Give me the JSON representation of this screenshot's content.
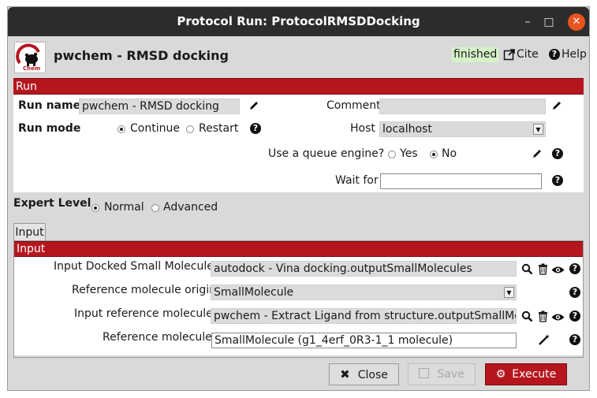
{
  "window": {
    "title": "Protocol Run: ProtocolRMSDDocking"
  },
  "header": {
    "logo_text": "Chem",
    "protocol_title": "pwchem - RMSD docking",
    "status": "finished",
    "cite_label": "Cite",
    "help_label": "Help"
  },
  "run_section": {
    "title": "Run",
    "run_name_label": "Run name",
    "run_name_value": "pwchem - RMSD docking",
    "comment_label": "Comment",
    "comment_value": "",
    "run_mode_label": "Run mode",
    "run_mode_options": [
      "Continue",
      "Restart"
    ],
    "run_mode_selected": "Continue",
    "host_label": "Host",
    "host_value": "localhost",
    "queue_label": "Use a queue engine?",
    "queue_options": [
      "Yes",
      "No"
    ],
    "queue_selected": "No",
    "wait_for_label": "Wait for",
    "wait_for_value": ""
  },
  "expert_level": {
    "label": "Expert Level",
    "options": [
      "Normal",
      "Advanced"
    ],
    "selected": "Normal"
  },
  "input_tab": {
    "tab_label": "Input",
    "section_title": "Input"
  },
  "input_section": {
    "docked_label": "Input Docked Small Molecules:",
    "docked_value": "autodock - Vina docking.outputSmallMolecules",
    "origin_label": "Reference molecule origin:",
    "origin_value": "SmallMolecule",
    "ref_mols_label": "Input reference molecules:",
    "ref_mols_value": "pwchem - Extract Ligand from structure.outputSmallMolecules",
    "ref_mol_label": "Reference molecule:",
    "ref_mol_value": "SmallMolecule (g1_4erf_0R3-1_1 molecule)"
  },
  "footer": {
    "close_label": "Close",
    "save_label": "Save",
    "execute_label": "Execute"
  },
  "colors": {
    "accent_red": "#b5161e",
    "titlebar": "#2c2c2c",
    "status_bg": "#d4f2c8",
    "close_circle": "#e95420"
  }
}
